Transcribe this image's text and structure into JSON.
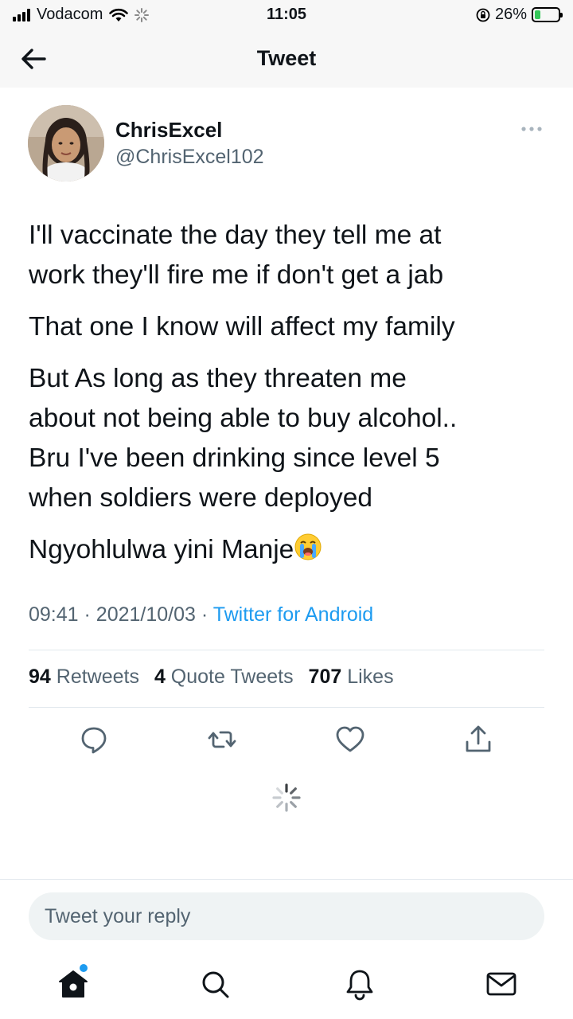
{
  "status_bar": {
    "carrier": "Vodacom",
    "time": "11:05",
    "battery_percent": "26%",
    "battery_level": 0.26
  },
  "header": {
    "title": "Tweet"
  },
  "tweet": {
    "author_name": "ChrisExcel",
    "author_handle": "@ChrisExcel102",
    "paragraphs": [
      "I'll vaccinate the day they tell me at",
      "work they'll fire me if don't get a jab",
      "That one I know will affect my family",
      "But As long as they threaten me",
      "about not being able to buy alcohol..",
      "Bru I've been drinking since level 5",
      "when soldiers were deployed",
      "Ngyohlulwa yini Manje"
    ],
    "time": "09:41",
    "date": "2021/10/03",
    "source": "Twitter for Android",
    "separator": "·"
  },
  "stats": {
    "retweets_count": "94",
    "retweets_label": "Retweets",
    "quotes_count": "4",
    "quotes_label": "Quote Tweets",
    "likes_count": "707",
    "likes_label": "Likes"
  },
  "reply": {
    "placeholder": "Tweet your reply"
  },
  "icons": {
    "back": "arrow-left-icon",
    "more": "ellipsis-icon",
    "reply": "comment-icon",
    "retweet": "retweet-icon",
    "like": "heart-icon",
    "share": "share-icon",
    "home": "home-icon",
    "search": "search-icon",
    "notifications": "bell-icon",
    "messages": "envelope-icon",
    "emoji": "loudly-crying-face-emoji"
  },
  "colors": {
    "accent": "#1d9bf0",
    "text": "#0f1419",
    "secondary": "#536471",
    "battery": "#34c759"
  }
}
